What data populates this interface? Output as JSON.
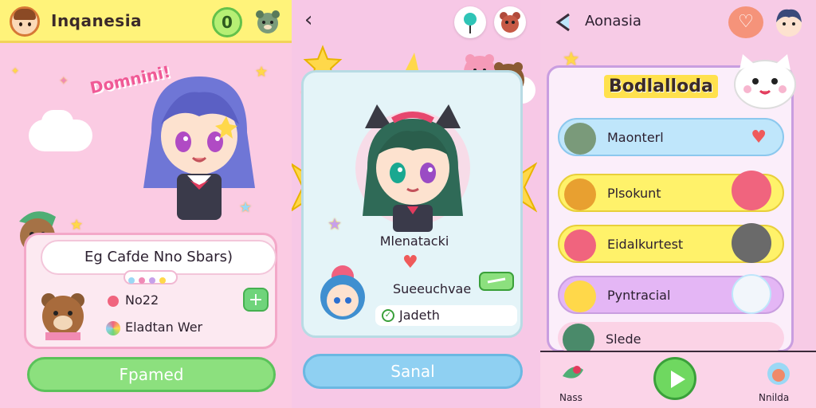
{
  "left_screen": {
    "title": "Inqanesia",
    "counter": "0",
    "banner_text": "Domnini!",
    "card_title": "Eg Cafde Nno Sbars)",
    "stat_1": "No22",
    "stat_2": "Eladtan Wer",
    "plus_label": "+",
    "button_label": "Fpamed"
  },
  "center_screen": {
    "back_icon": "‹",
    "character_name": "Mlenatacki",
    "sub_label_1": "Sueeuchvae",
    "sub_label_2": "Jadeth",
    "button_label": "Sanal"
  },
  "right_screen": {
    "title": "Aonasia",
    "heading": "Bodlalloda",
    "items": [
      {
        "label": "Maonterl",
        "color": "#bfe6fb"
      },
      {
        "label": "Plsokunt",
        "color": "#fff26a"
      },
      {
        "label": "Eidalkurtest",
        "color": "#fff26a"
      },
      {
        "label": "Pyntracial",
        "color": "#e4b6f5"
      },
      {
        "label": "Slede",
        "color": "#fbd3e6"
      }
    ],
    "nav_left_label": "Nass",
    "nav_right_label": "Nnilda"
  },
  "colors": {
    "pink_bg": "#fbcbe3",
    "yellow_header": "#fff37a",
    "green_button": "#8ce07e",
    "blue_button": "#8fd0f2",
    "purple_border": "#c99ee0"
  }
}
